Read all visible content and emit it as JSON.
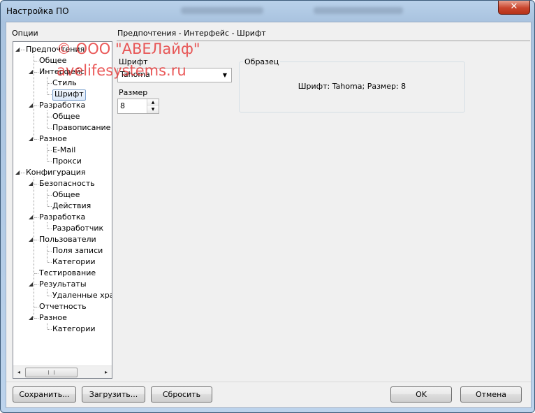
{
  "window": {
    "title": "Настройка ПО",
    "close_glyph": "✕"
  },
  "left": {
    "header": "Опции"
  },
  "right": {
    "header": "Предпочтения - Интерфейс - Шрифт"
  },
  "tree": {
    "items": [
      {
        "label": "Предпочтения",
        "expander": "◢"
      },
      {
        "label": "Общее"
      },
      {
        "label": "Интерфейс",
        "expander": "◢"
      },
      {
        "label": "Стиль"
      },
      {
        "label": "Шрифт"
      },
      {
        "label": "Разработка",
        "expander": "◢"
      },
      {
        "label": "Общее"
      },
      {
        "label": "Правописание"
      },
      {
        "label": "Разное",
        "expander": "◢"
      },
      {
        "label": "E-Mail"
      },
      {
        "label": "Прокси"
      },
      {
        "label": "Конфигурация",
        "expander": "◢"
      },
      {
        "label": "Безопасность",
        "expander": "◢"
      },
      {
        "label": "Общее"
      },
      {
        "label": "Действия"
      },
      {
        "label": "Разработка",
        "expander": "◢"
      },
      {
        "label": "Разработчик"
      },
      {
        "label": "Пользователи",
        "expander": "◢"
      },
      {
        "label": "Поля записи"
      },
      {
        "label": "Категории"
      },
      {
        "label": "Тестирование"
      },
      {
        "label": "Результаты",
        "expander": "◢"
      },
      {
        "label": "Удаленные хра"
      },
      {
        "label": "Отчетность"
      },
      {
        "label": "Разное",
        "expander": "◢"
      },
      {
        "label": "Категории"
      }
    ],
    "selected": "Шрифт",
    "scroll_left": "◂",
    "scroll_right": "▸"
  },
  "font_field": {
    "label": "Шрифт",
    "value": "Tahoma",
    "arrow": "▼"
  },
  "size_field": {
    "label": "Размер",
    "value": "8",
    "up": "▲",
    "down": "▼"
  },
  "sample": {
    "title": "Образец",
    "text": "Шрифт: Tahoma; Размер: 8"
  },
  "buttons": {
    "save": "Сохранить...",
    "load": "Загрузить...",
    "reset": "Сбросить",
    "ok": "OK",
    "cancel": "Отмена"
  },
  "watermark": {
    "line1": "© ООО \"АВЕЛайф\"",
    "line2": "avelifesystems.ru"
  }
}
